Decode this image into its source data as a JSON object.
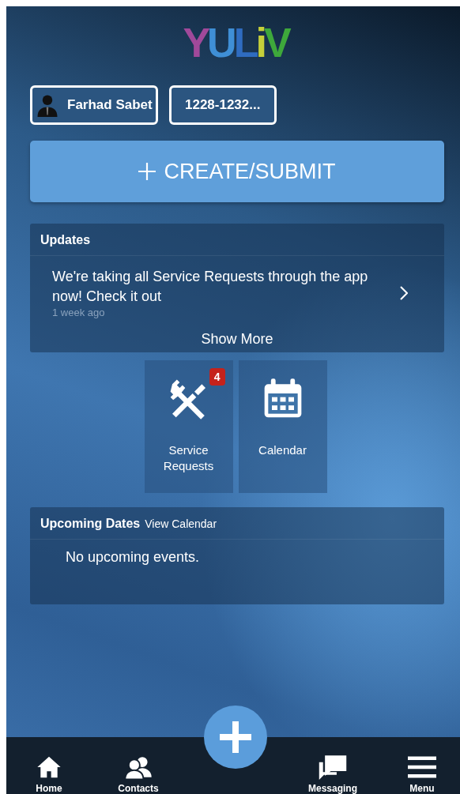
{
  "logo": {
    "letters": [
      {
        "char": "Y",
        "color": "#a0499a"
      },
      {
        "char": "U",
        "color": "#3f8fd6"
      },
      {
        "char": "L",
        "color": "#2f6cc0"
      },
      {
        "char": "i",
        "color": "#c5cf3a"
      },
      {
        "char": "V",
        "color": "#3ea83b"
      }
    ]
  },
  "chips": [
    {
      "kind": "user",
      "label": "Farhad Sabet"
    },
    {
      "kind": "account",
      "label": "1228-1232..."
    }
  ],
  "create_button": {
    "label": "CREATE/SUBMIT"
  },
  "updates": {
    "title": "Updates",
    "items": [
      {
        "text": "We're taking all Service Requests through the app now! Check it out",
        "time": "1 week ago"
      }
    ],
    "show_more": "Show More"
  },
  "tiles": [
    {
      "kind": "service",
      "label": "Service Requests",
      "badge": "4"
    },
    {
      "kind": "calendar",
      "label": "Calendar"
    }
  ],
  "upcoming": {
    "title": "Upcoming Dates",
    "link": "View Calendar",
    "empty": "No upcoming events."
  },
  "nav": [
    {
      "kind": "home",
      "label": "Home"
    },
    {
      "kind": "contacts",
      "label": "Contacts"
    },
    {
      "kind": "fab"
    },
    {
      "kind": "messaging",
      "label": "Messaging"
    },
    {
      "kind": "menu",
      "label": "Menu"
    }
  ]
}
